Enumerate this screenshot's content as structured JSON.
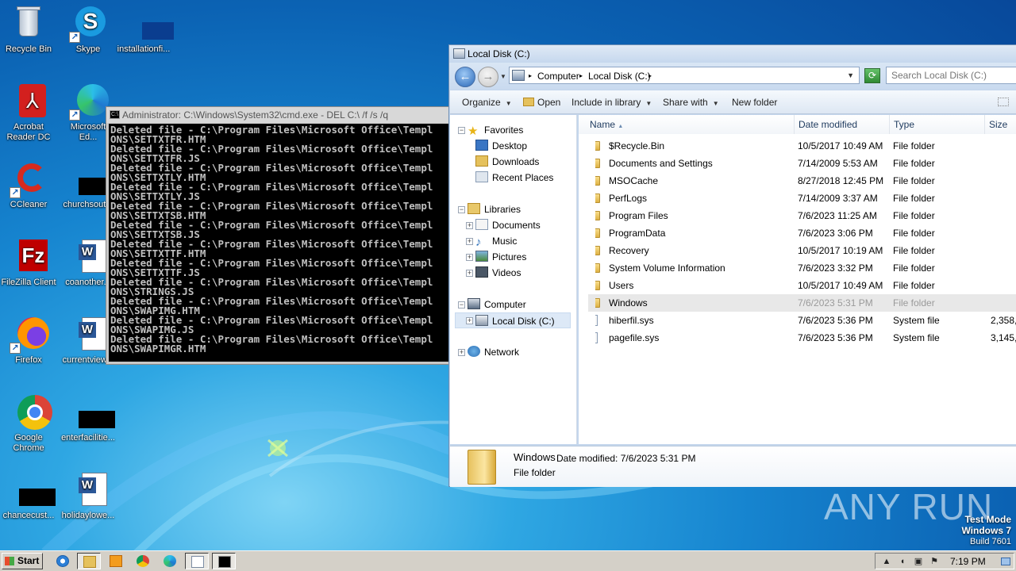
{
  "desktop": {
    "icons": [
      {
        "label": "Recycle Bin",
        "icon": "recycle-bin-icon"
      },
      {
        "label": "Skype",
        "icon": "skype-icon"
      },
      {
        "label": "installationfi...",
        "icon": "blank-file-icon"
      },
      {
        "label": "Acrobat Reader DC",
        "icon": "acrobat-icon"
      },
      {
        "label": "Microsoft Ed...",
        "icon": "edge-icon"
      },
      {
        "label": "CCleaner",
        "icon": "ccleaner-icon"
      },
      {
        "label": "churchsout...",
        "icon": "blank-file-icon"
      },
      {
        "label": "FileZilla Client",
        "icon": "filezilla-icon"
      },
      {
        "label": "coanother...",
        "icon": "word-doc-icon"
      },
      {
        "label": "Firefox",
        "icon": "firefox-icon"
      },
      {
        "label": "currentview...",
        "icon": "word-doc-icon"
      },
      {
        "label": "Google Chrome",
        "icon": "chrome-icon"
      },
      {
        "label": "enterfacilitie...",
        "icon": "blank-file-icon"
      },
      {
        "label": "chancecust...",
        "icon": "blank-file-icon"
      },
      {
        "label": "holidaylowe...",
        "icon": "word-doc-icon"
      }
    ]
  },
  "cmd": {
    "title": "Administrator: C:\\Windows\\System32\\cmd.exe - DEL  C:\\ /f /s /q",
    "lines": [
      "Deleted file - C:\\Program Files\\Microsoft Office\\Templ",
      "ONS\\SETTXTFR.HTM",
      "Deleted file - C:\\Program Files\\Microsoft Office\\Templ",
      "ONS\\SETTXTFR.JS",
      "Deleted file - C:\\Program Files\\Microsoft Office\\Templ",
      "ONS\\SETTXTLY.HTM",
      "Deleted file - C:\\Program Files\\Microsoft Office\\Templ",
      "ONS\\SETTXTLY.JS",
      "Deleted file - C:\\Program Files\\Microsoft Office\\Templ",
      "ONS\\SETTXTSB.HTM",
      "Deleted file - C:\\Program Files\\Microsoft Office\\Templ",
      "ONS\\SETTXTSB.JS",
      "Deleted file - C:\\Program Files\\Microsoft Office\\Templ",
      "ONS\\SETTXTTF.HTM",
      "Deleted file - C:\\Program Files\\Microsoft Office\\Templ",
      "ONS\\SETTXTTF.JS",
      "Deleted file - C:\\Program Files\\Microsoft Office\\Templ",
      "ONS\\STRINGS.JS",
      "Deleted file - C:\\Program Files\\Microsoft Office\\Templ",
      "ONS\\SWAPIMG.HTM",
      "Deleted file - C:\\Program Files\\Microsoft Office\\Templ",
      "ONS\\SWAPIMG.JS",
      "Deleted file - C:\\Program Files\\Microsoft Office\\Templ",
      "ONS\\SWAPIMGR.HTM"
    ]
  },
  "explorer": {
    "title": "Local Disk (C:)",
    "breadcrumb": [
      "Computer",
      "Local Disk (C:)"
    ],
    "search_placeholder": "Search Local Disk (C:)",
    "toolbar": {
      "organize": "Organize",
      "open": "Open",
      "include": "Include in library",
      "share": "Share with",
      "new_folder": "New folder"
    },
    "nav": {
      "favorites": "Favorites",
      "desktop": "Desktop",
      "downloads": "Downloads",
      "recent": "Recent Places",
      "libraries": "Libraries",
      "documents": "Documents",
      "music": "Music",
      "pictures": "Pictures",
      "videos": "Videos",
      "computer": "Computer",
      "local_disk": "Local Disk (C:)",
      "network": "Network"
    },
    "columns": {
      "name": "Name",
      "date": "Date modified",
      "type": "Type",
      "size": "Size"
    },
    "files": [
      {
        "name": "$Recycle.Bin",
        "date": "10/5/2017 10:49 AM",
        "type": "File folder",
        "size": "",
        "kind": "locked-folder"
      },
      {
        "name": "Documents and Settings",
        "date": "7/14/2009 5:53 AM",
        "type": "File folder",
        "size": "",
        "kind": "locked-folder"
      },
      {
        "name": "MSOCache",
        "date": "8/27/2018 12:45 PM",
        "type": "File folder",
        "size": "",
        "kind": "locked-folder"
      },
      {
        "name": "PerfLogs",
        "date": "7/14/2009 3:37 AM",
        "type": "File folder",
        "size": "",
        "kind": "folder"
      },
      {
        "name": "Program Files",
        "date": "7/6/2023 11:25 AM",
        "type": "File folder",
        "size": "",
        "kind": "folder"
      },
      {
        "name": "ProgramData",
        "date": "7/6/2023 3:06 PM",
        "type": "File folder",
        "size": "",
        "kind": "folder"
      },
      {
        "name": "Recovery",
        "date": "10/5/2017 10:19 AM",
        "type": "File folder",
        "size": "",
        "kind": "locked-folder"
      },
      {
        "name": "System Volume Information",
        "date": "7/6/2023 3:32 PM",
        "type": "File folder",
        "size": "",
        "kind": "locked-folder"
      },
      {
        "name": "Users",
        "date": "10/5/2017 10:49 AM",
        "type": "File folder",
        "size": "",
        "kind": "folder"
      },
      {
        "name": "Windows",
        "date": "7/6/2023 5:31 PM",
        "type": "File folder",
        "size": "",
        "kind": "folder",
        "selected": true
      },
      {
        "name": "hiberfil.sys",
        "date": "7/6/2023 5:36 PM",
        "type": "System file",
        "size": "2,358,",
        "kind": "sys"
      },
      {
        "name": "pagefile.sys",
        "date": "7/6/2023 5:36 PM",
        "type": "System file",
        "size": "3,145,",
        "kind": "sys"
      }
    ],
    "details": {
      "name": "Windows",
      "modified": "Date modified:  7/6/2023 5:31 PM",
      "type": "File folder"
    }
  },
  "watermark": "ANY RUN",
  "test_mode": {
    "line1": "Test Mode",
    "line2": "Windows 7",
    "line3": "Build 7601"
  },
  "taskbar": {
    "start_label": "Start",
    "clock": "7:19 PM"
  }
}
